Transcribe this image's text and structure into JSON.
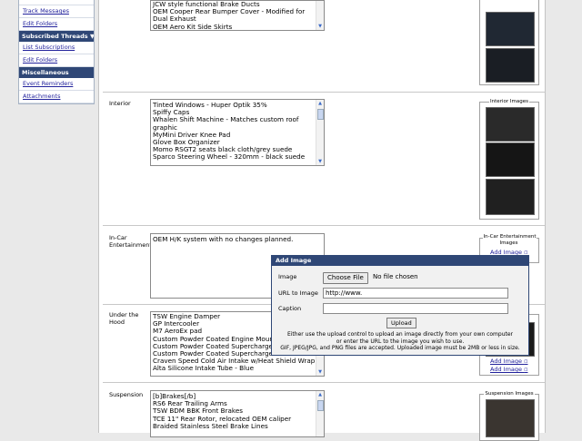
{
  "sidebar": {
    "items": [
      {
        "label": "Track Messages",
        "type": "link"
      },
      {
        "label": "Edit Folders",
        "type": "link"
      },
      {
        "label": "Subscribed Threads",
        "type": "header"
      },
      {
        "label": "List Subscriptions",
        "type": "link"
      },
      {
        "label": "Edit Folders",
        "type": "link"
      },
      {
        "label": "Miscellaneous",
        "type": "header"
      },
      {
        "label": "Event Reminders",
        "type": "link"
      },
      {
        "label": "Attachments",
        "type": "link"
      }
    ]
  },
  "sections": {
    "exterior": {
      "lines": [
        "JCW style functional Brake Ducts",
        "OEM Cooper Rear Bumper Cover - Modified for",
        "Dual Exhaust",
        "OEM Aero Kit Side Skirts"
      ]
    },
    "interior": {
      "label": "Interior",
      "lines": [
        "Tinted Windows - Huper Optik 35%",
        "Spiffy Caps",
        "Whalen Shift Machine - Matches custom roof",
        "graphic",
        "MyMini Driver Knee Pad",
        "Glove Box Organizer",
        "Momo RSGT2 seats black cloth/grey suede",
        "Sparco Steering Wheel - 320mm - black suede"
      ],
      "images_title": "Interior Images"
    },
    "incar": {
      "label": "In-Car Entertainment",
      "lines": [
        "OEM H/K system with no changes planned."
      ],
      "images_title": "In-Car Entertainment Images",
      "add_image": "Add Image"
    },
    "underhood": {
      "label": "Under the Hood",
      "lines": [
        "TSW Engine Damper",
        "GP Intercooler",
        "M7 AeroEx pad",
        "Custom Powder Coated Engine Mount",
        "Custom Powder Coated Supercharger",
        "Custom Powder Coated Supercharger",
        "Craven Speed Cold Air Intake w/Heat Shield Wrap",
        "Alta Silicone Intake Tube - Blue"
      ],
      "add_image_1": "Add Image",
      "add_image_2": "Add Image"
    },
    "suspension": {
      "label": "Suspension",
      "lines": [
        "[b]Brakes[/b]",
        "RS6 Rear Trailing Arms",
        "TSW BDM BBK Front Brakes",
        "TCE 11\" Rear Rotor, relocated OEM caliper",
        "Braided Stainless Steel Brake Lines"
      ],
      "images_title": "Suspension Images"
    }
  },
  "modal": {
    "title": "Add Image",
    "image_label": "Image",
    "choose_file": "Choose File",
    "no_file": "No file chosen",
    "url_label": "URL to Image",
    "url_value": "http://www.",
    "caption_label": "Caption",
    "caption_value": "",
    "upload_label": "Upload",
    "help_1": "Either use the upload control to upload an image directly from your own computer",
    "help_2": "or enter the URL to the image you wish to use.",
    "help_3": "GIF, JPEG/JPG, and PNG files are accepted. Uploaded image must be 2MB or less in size."
  }
}
